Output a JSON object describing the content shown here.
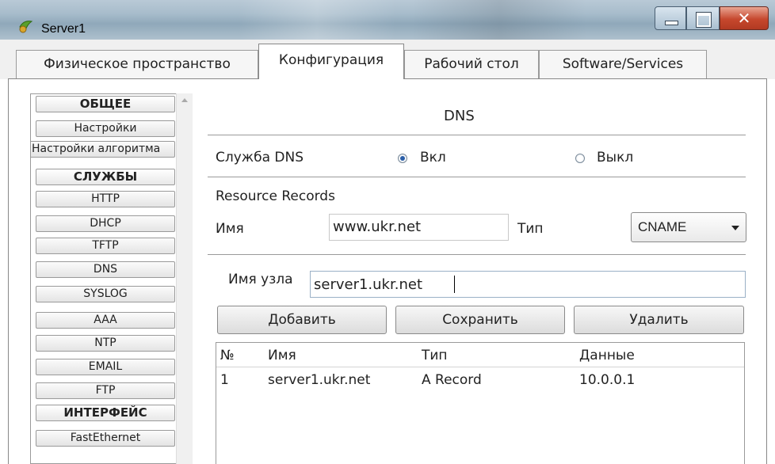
{
  "window": {
    "title": "Server1"
  },
  "tabs": [
    {
      "label": "Физическое пространство"
    },
    {
      "label": "Конфигурация"
    },
    {
      "label": "Рабочий стол"
    },
    {
      "label": "Software/Services"
    }
  ],
  "sidebar": {
    "items": [
      {
        "label": "ОБЩЕЕ"
      },
      {
        "label": "Настройки"
      },
      {
        "label": "Настройки алгоритма"
      },
      {
        "label": "СЛУЖБЫ"
      },
      {
        "label": "HTTP"
      },
      {
        "label": "DHCP"
      },
      {
        "label": "TFTP"
      },
      {
        "label": "DNS"
      },
      {
        "label": "SYSLOG"
      },
      {
        "label": "AAA"
      },
      {
        "label": "NTP"
      },
      {
        "label": "EMAIL"
      },
      {
        "label": "FTP"
      },
      {
        "label": "ИНТЕРФЕЙС"
      },
      {
        "label": "FastEthernet"
      }
    ]
  },
  "dns": {
    "title": "DNS",
    "service_label": "Служба DNS",
    "on_label": "Вкл",
    "off_label": "Выкл",
    "selected": "Вкл",
    "resource_records_label": "Resource Records",
    "name_label": "Имя",
    "name_value": "www.ukr.net",
    "type_label": "Тип",
    "type_value": "CNAME",
    "host_label": "Имя узла",
    "host_value": "server1.ukr.net",
    "buttons": {
      "add": "Добавить",
      "save": "Сохранить",
      "delete": "Удалить"
    },
    "table": {
      "columns": [
        "№",
        "Имя",
        "Тип",
        "Данные"
      ],
      "rows": [
        {
          "num": "1",
          "name": "server1.ukr.net",
          "type": "A Record",
          "data": "10.0.0.1"
        }
      ]
    }
  },
  "colors": {
    "titlebar": "#a7bccb",
    "close_button": "#c6472d",
    "radio_selected": "#2a5ea8"
  }
}
